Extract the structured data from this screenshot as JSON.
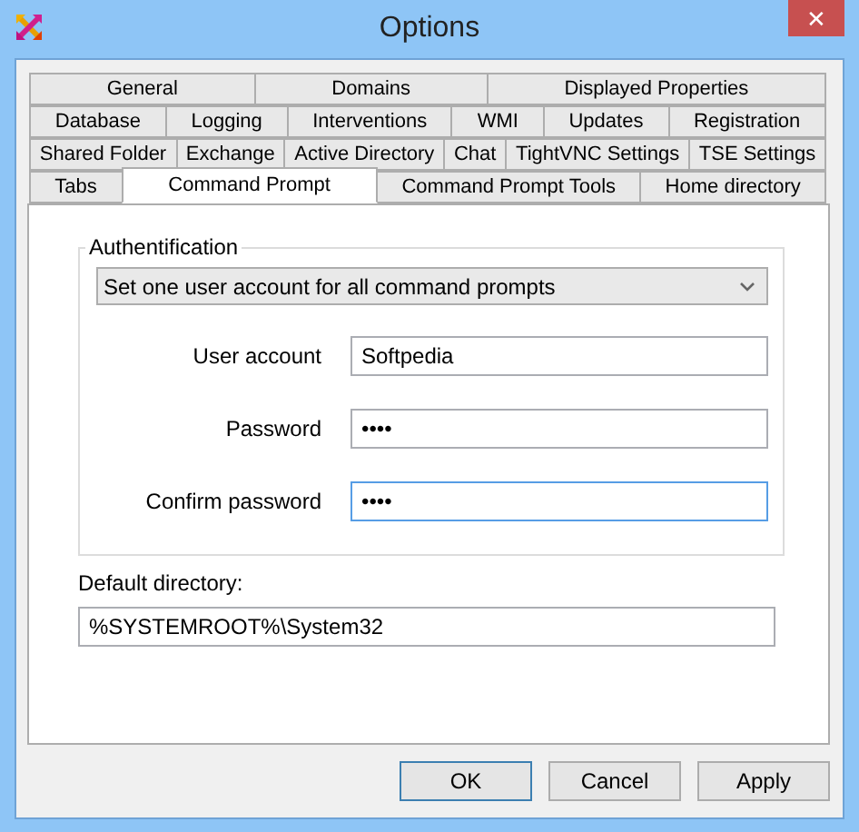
{
  "window": {
    "title": "Options",
    "close": "✕"
  },
  "tab_rows": [
    {
      "tabs": [
        {
          "label": "General",
          "selected": false
        },
        {
          "label": "Domains",
          "selected": false
        },
        {
          "label": "Displayed Properties",
          "selected": false
        }
      ]
    },
    {
      "tabs": [
        {
          "label": "Database",
          "selected": false
        },
        {
          "label": "Logging",
          "selected": false
        },
        {
          "label": "Interventions",
          "selected": false
        },
        {
          "label": "WMI",
          "selected": false
        },
        {
          "label": "Updates",
          "selected": false
        },
        {
          "label": "Registration",
          "selected": false
        }
      ]
    },
    {
      "tabs": [
        {
          "label": "Shared Folder",
          "selected": false
        },
        {
          "label": "Exchange",
          "selected": false
        },
        {
          "label": "Active Directory",
          "selected": false
        },
        {
          "label": "Chat",
          "selected": false
        },
        {
          "label": "TightVNC Settings",
          "selected": false
        },
        {
          "label": "TSE Settings",
          "selected": false
        }
      ]
    },
    {
      "tabs": [
        {
          "label": "Tabs",
          "selected": false
        },
        {
          "label": "Command Prompt",
          "selected": true
        },
        {
          "label": "Command Prompt Tools",
          "selected": false
        },
        {
          "label": "Home directory",
          "selected": false
        }
      ]
    }
  ],
  "authentification": {
    "title": "Authentification",
    "dropdown": "Set one user account for all command prompts",
    "fields": [
      {
        "label": "User account",
        "value": "Softpedia",
        "focused": false
      },
      {
        "label": "Password",
        "value": "••••",
        "focused": false
      },
      {
        "label": "Confirm password",
        "value": "••••",
        "focused": true
      }
    ]
  },
  "default_directory": {
    "label": "Default directory:",
    "value": "%SYSTEMROOT%\\System32"
  },
  "buttons": [
    {
      "label": "OK",
      "default": true
    },
    {
      "label": "Cancel",
      "default": false
    },
    {
      "label": "Apply",
      "default": false
    }
  ]
}
